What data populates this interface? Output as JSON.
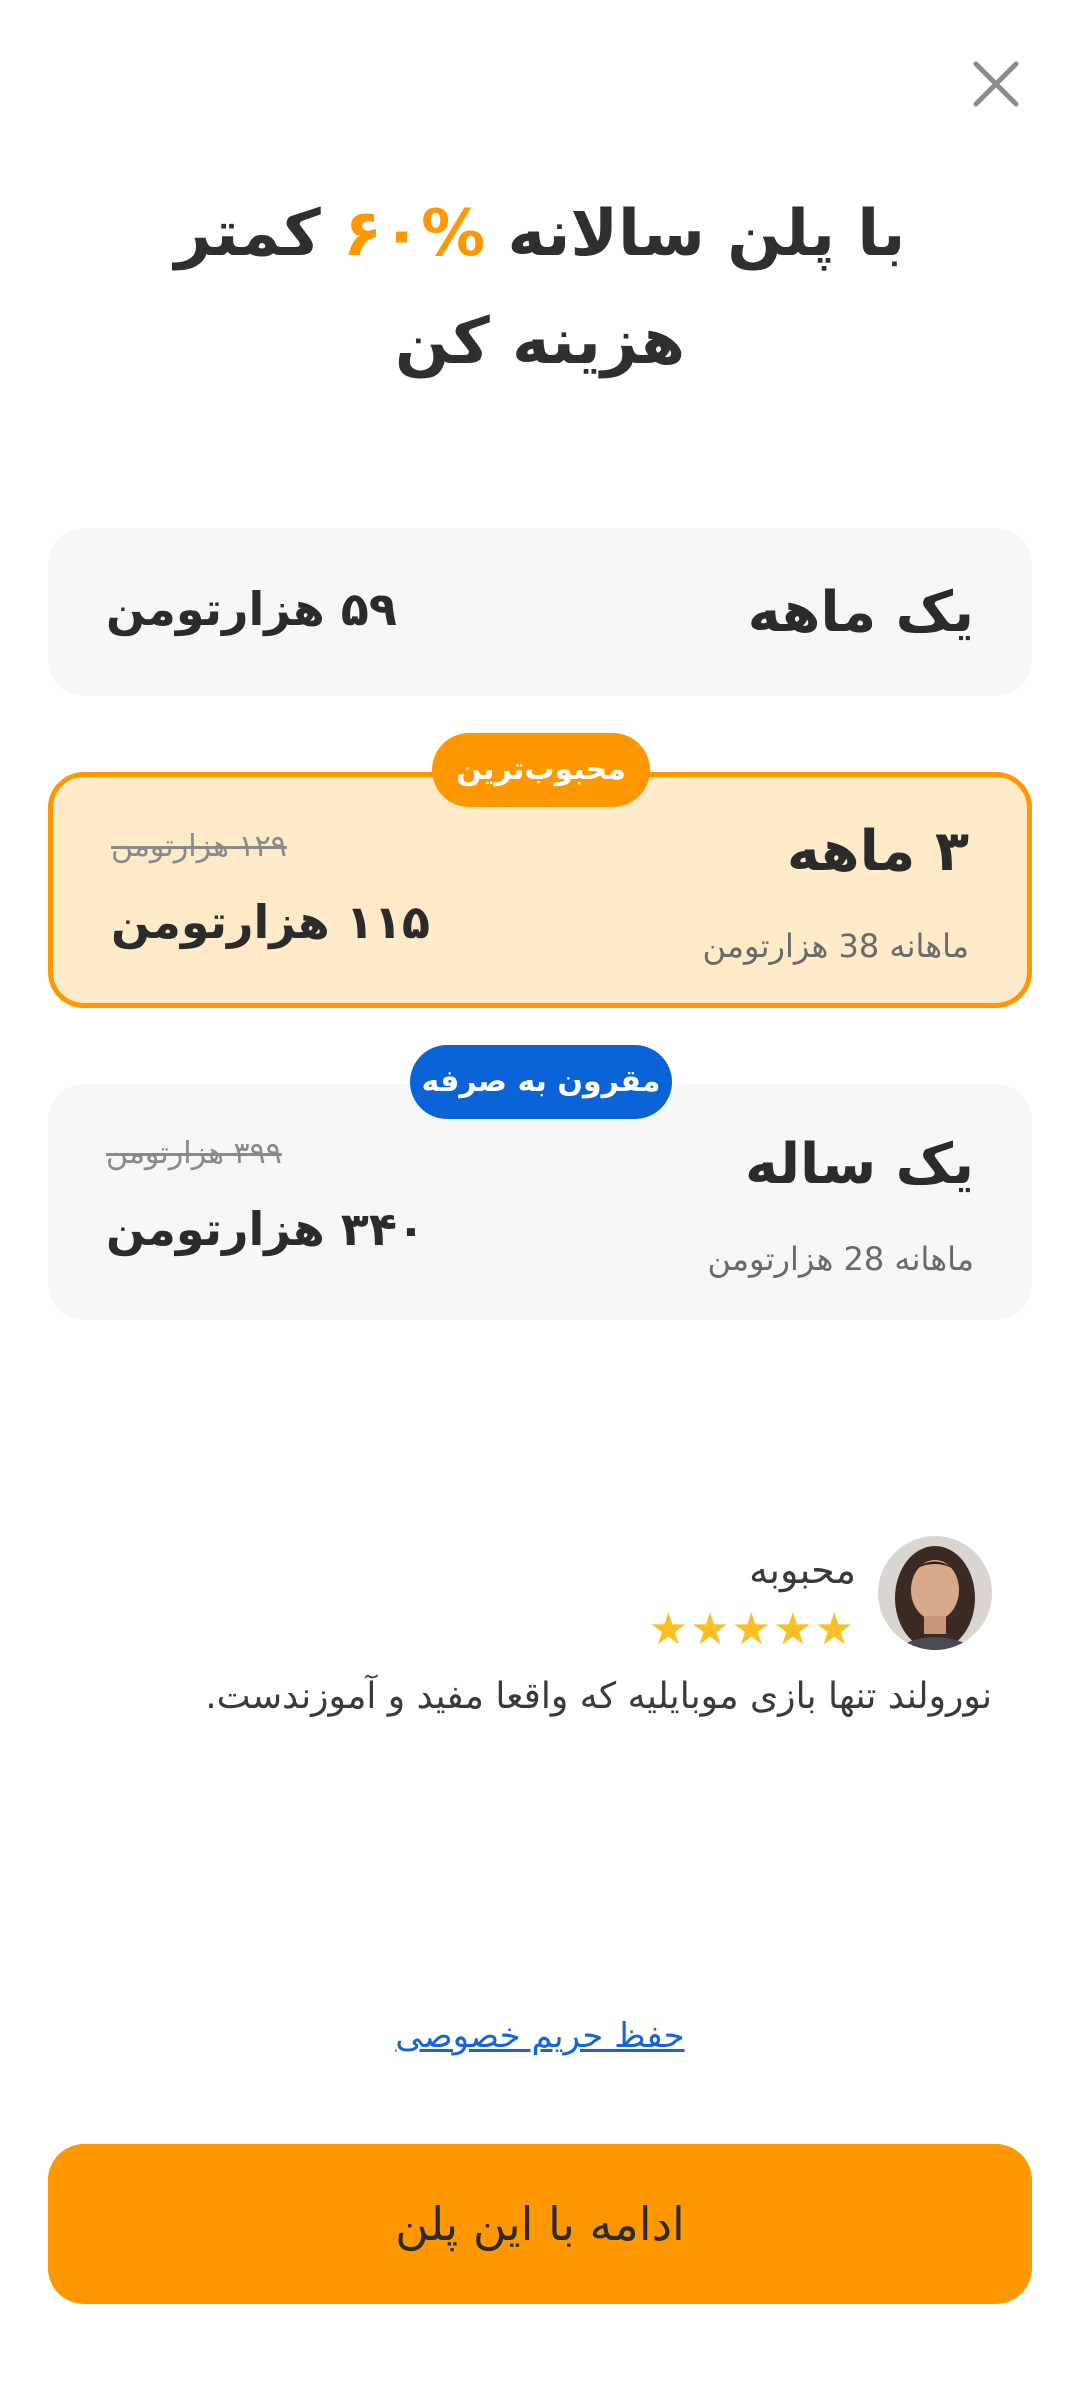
{
  "header": {
    "close_icon": "close-icon",
    "title_part1": "با پلن سالانه",
    "title_accent": "%۶۰",
    "title_part2": "کمتر",
    "title_line2": "هزینه کن",
    "accent_color": "#ff9800"
  },
  "plans": [
    {
      "name": "یک ماهه",
      "price": "۵۹ هزارتومن",
      "selected": false
    },
    {
      "name": "۳ ماهه",
      "monthly": "ماهانه 38 هزارتومن",
      "old_price": "۱۲۹ هزارتومن",
      "price": "۱۱۵ هزارتومن",
      "badge": "محبوب‌ترین",
      "selected": true
    },
    {
      "name": "یک ساله",
      "monthly": "ماهانه 28 هزارتومن",
      "old_price": "۳۹۹ هزارتومن",
      "price": "۳۴۰ هزارتومن",
      "badge": "مقرون به صرفه",
      "selected": false
    }
  ],
  "review": {
    "avatar": "reviewer-avatar",
    "name": "محبوبه",
    "rating": 5,
    "stars": "★★★★★",
    "text": "نورولند تنها بازی موبایلیه که واقعا مفید و آموزندست."
  },
  "privacy_link": "حفظ حریم خصوصی",
  "cta_label": "ادامه با این پلن",
  "colors": {
    "primary": "#ff9800",
    "selected_bg": "#ffebc9",
    "card_bg": "#f7f7f7",
    "badge_blue": "#0a64d8",
    "link": "#1565d8",
    "star": "#fbbf24"
  }
}
